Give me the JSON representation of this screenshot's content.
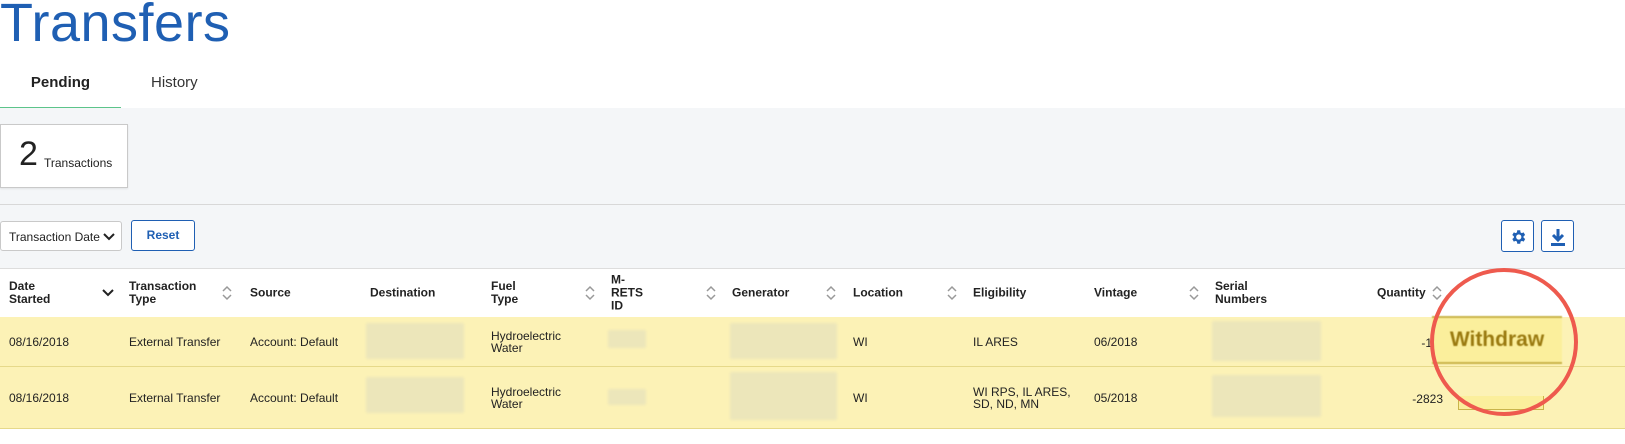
{
  "page": {
    "title": "Transfers"
  },
  "tabs": [
    {
      "label": "Pending"
    },
    {
      "label": "History"
    }
  ],
  "summary": {
    "count": "2",
    "label": "Transactions"
  },
  "toolbar": {
    "sort_value": "Transaction Date",
    "reset_label": "Reset"
  },
  "icons": {
    "settings": "gear-icon",
    "download": "download-icon"
  },
  "table": {
    "columns": [
      "Date Started",
      "Transaction Type",
      "Source",
      "Destination",
      "Fuel Type",
      "M-RETS ID",
      "Generator",
      "Location",
      "Eligibility",
      "Vintage",
      "Serial Numbers",
      "Quantity"
    ],
    "rows": [
      {
        "date": "08/16/2018",
        "type": "External Transfer",
        "source": "Account: Default",
        "fuel1": "Hydroelectric",
        "fuel2": "Water",
        "location": "WI",
        "elig1": "IL ARES",
        "elig2": "",
        "vintage": "06/2018",
        "quantity": "-1",
        "action": "Withdraw"
      },
      {
        "date": "08/16/2018",
        "type": "External Transfer",
        "source": "Account: Default",
        "fuel1": "Hydroelectric",
        "fuel2": "Water",
        "location": "WI",
        "elig1": "WI RPS, IL ARES,",
        "elig2": "SD, ND, MN",
        "vintage": "05/2018",
        "quantity": "-2823",
        "action": ""
      }
    ]
  },
  "colors": {
    "accent": "#1f5fb3",
    "tab_active": "#5cc48a",
    "row_highlight": "#fcf2b6",
    "annotation": "#ee5a4e"
  }
}
